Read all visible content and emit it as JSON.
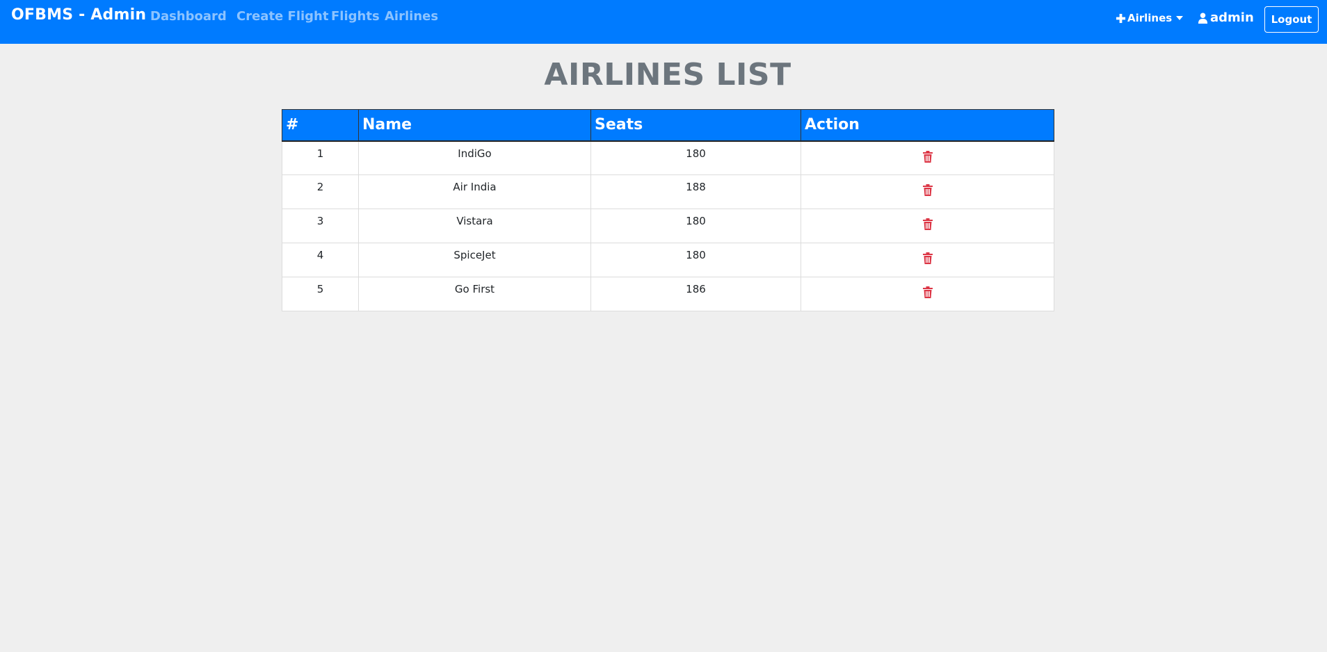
{
  "nav": {
    "brand": "OFBMS - Admin",
    "links": [
      {
        "label": "Dashboard"
      },
      {
        "label": "Create Flight"
      },
      {
        "label": "Flights"
      },
      {
        "label": "Airlines"
      }
    ],
    "dropdown_label": "Airlines",
    "user_label": "admin",
    "logout_label": "Logout",
    "icons": {
      "dropdown": "plus-icon",
      "caret": "caret-down-icon",
      "user": "user-icon"
    }
  },
  "page": {
    "title": "AIRLINES LIST"
  },
  "table": {
    "headers": [
      "#",
      "Name",
      "Seats",
      "Action"
    ],
    "rows": [
      {
        "index": "1",
        "name": "IndiGo",
        "seats": "180",
        "action_icon": "trash-icon"
      },
      {
        "index": "2",
        "name": "Air India",
        "seats": "188",
        "action_icon": "trash-icon"
      },
      {
        "index": "3",
        "name": "Vistara",
        "seats": "180",
        "action_icon": "trash-icon"
      },
      {
        "index": "4",
        "name": "SpiceJet",
        "seats": "180",
        "action_icon": "trash-icon"
      },
      {
        "index": "5",
        "name": "Go First",
        "seats": "186",
        "action_icon": "trash-icon"
      }
    ]
  },
  "colors": {
    "navbar": "#007bff",
    "background": "#efefef",
    "title": "#6c757d",
    "delete": "#dc3545"
  }
}
